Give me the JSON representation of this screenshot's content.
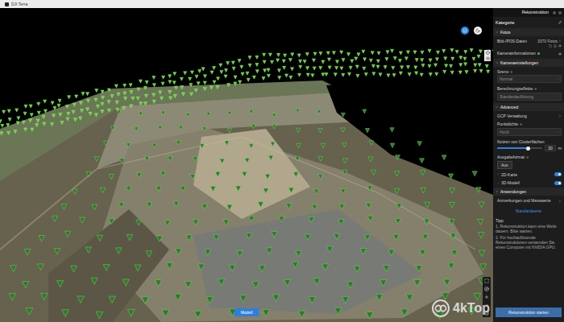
{
  "window": {
    "title": "DJI Terra"
  },
  "header": {
    "mode": "Rekonstruktion"
  },
  "viewport": {
    "button": "Modell"
  },
  "panel": {
    "title": "Kategorie",
    "rows": [
      {
        "kind": "section",
        "label": "Fotos",
        "expanded": true
      },
      {
        "kind": "info",
        "label": "Bild-/POS-Daten",
        "value": "3370 Fotos"
      },
      {
        "kind": "status",
        "label": "Kamerainformationen",
        "ok": true
      },
      {
        "kind": "section",
        "label": "Kameraeinstellungen",
        "expanded": true
      },
      {
        "kind": "dropdown",
        "label": "Szene",
        "value": "Normal"
      },
      {
        "kind": "dropdown",
        "label": "Berechnungseffekte",
        "value": "Standardauflösung"
      },
      {
        "kind": "section",
        "label": "Advanced",
        "expanded": true
      },
      {
        "kind": "nav",
        "label": "GCP Verwaltung"
      },
      {
        "kind": "dropdown",
        "label": "Punktdichte",
        "value": "Hoch"
      },
      {
        "kind": "slider",
        "label": "Nutzen von Clusterflächen",
        "level": 0.7,
        "reading": "30",
        "unit": "m"
      },
      {
        "kind": "button",
        "label": "Ausgabeformat",
        "value": "Aus"
      },
      {
        "kind": "toggle",
        "label": "2D-Karte",
        "on": true
      },
      {
        "kind": "toggle",
        "label": "3D-Modell",
        "on": true
      },
      {
        "kind": "section",
        "label": "Anwendungen",
        "expanded": false
      },
      {
        "kind": "nav",
        "label": "Anmerkungen und Messwerte"
      }
    ],
    "link": "Standardwerte",
    "tips": {
      "title": "Tipp:",
      "lines": [
        "1. Rekonstruktion kann eine Weile dauern. Bitte warten.",
        "2. Für hochauflösende Rekonstruktionen verwenden Sie einen Computer mit NVIDIA GPU."
      ]
    },
    "start": "Rekonstruktion starten"
  },
  "watermark": "4kTop"
}
